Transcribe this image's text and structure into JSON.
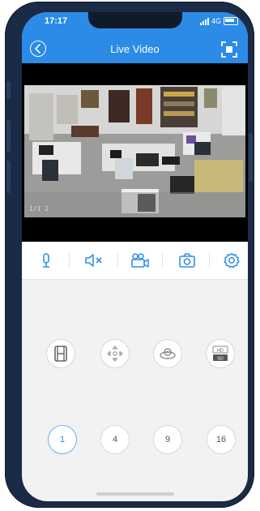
{
  "status_bar": {
    "time": "17:17",
    "network": "4G"
  },
  "header": {
    "title": "Live Video"
  },
  "video": {
    "timestamp": "1/1 2"
  },
  "toolbar": {
    "items": [
      {
        "name": "microphone",
        "icon": "microphone-icon"
      },
      {
        "name": "mute",
        "icon": "speaker-mute-icon"
      },
      {
        "name": "record",
        "icon": "video-record-icon"
      },
      {
        "name": "snapshot",
        "icon": "camera-icon"
      },
      {
        "name": "settings",
        "icon": "gear-icon"
      }
    ]
  },
  "function_buttons": [
    {
      "name": "playback",
      "icon": "film-icon"
    },
    {
      "name": "ptz",
      "icon": "directional-pad-icon"
    },
    {
      "name": "fisheye",
      "icon": "fisheye-icon"
    },
    {
      "name": "quality",
      "icon": "hd-sd-icon",
      "hd_label": "HD",
      "sd_label": "SD"
    }
  ],
  "split_buttons": {
    "options": [
      "1",
      "4",
      "9",
      "16"
    ],
    "selected": "1"
  },
  "colors": {
    "accent": "#2b8be6",
    "icon_blue": "#2f8fe8",
    "phone_frame": "#1b2b45"
  }
}
